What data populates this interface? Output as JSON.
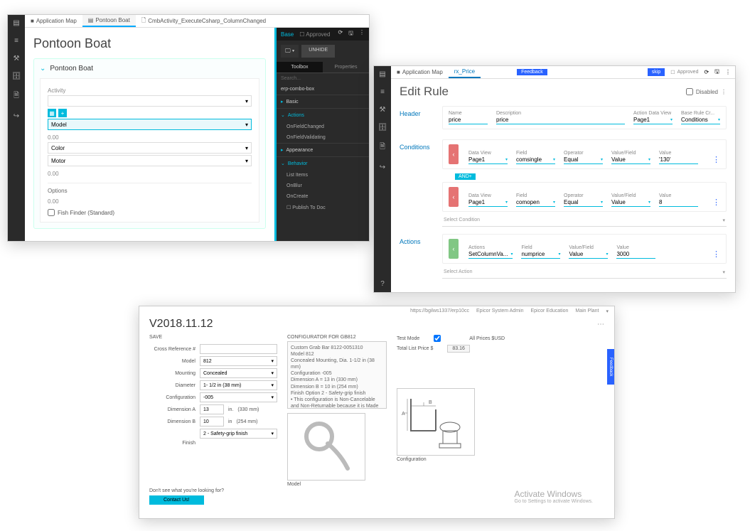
{
  "winA": {
    "tabs": [
      "Application Map",
      "Pontoon Boat",
      "CmbActivity_ExecuteCsharp_ColumnChanged"
    ],
    "title": "Pontoon Boat",
    "card_title": "Pontoon Boat",
    "fields": {
      "activity": "Activity",
      "model": "Model",
      "num1": "0.00",
      "color": "Color",
      "motor": "Motor",
      "num2": "0.00",
      "options": "Options",
      "num3": "0.00",
      "fish": "Fish Finder (Standard)"
    },
    "right": {
      "state_base": "Base",
      "state_approved": "Approved",
      "unhide": "UNHIDE",
      "panetabs": [
        "Toolbox",
        "Properties"
      ],
      "search": "Search...",
      "crumb": "erp-combo-box",
      "sections": {
        "basic": "Basic",
        "actions": "Actions",
        "appearance": "Appearance",
        "behavior": "Behavior"
      },
      "items": {
        "onfieldchanged": "OnFieldChanged",
        "onfieldvalidating": "OnFieldValidating",
        "listitems": "List Items",
        "onblur": "OnBlur",
        "oncreate": "OnCreate",
        "publish": "Publish To Doc"
      }
    }
  },
  "winB": {
    "tabs": [
      "Application Map",
      "rx_Price"
    ],
    "feedback": "Feedback",
    "skip": "skip",
    "approved": "Approved",
    "title": "Edit Rule",
    "disabled": "Disabled",
    "labels": {
      "header": "Header",
      "conditions": "Conditions",
      "actions": "Actions"
    },
    "header": {
      "name_l": "Name",
      "name_v": "price",
      "desc_l": "Description",
      "desc_v": "price",
      "adv_l": "Action Data View",
      "adv_v": "Page1",
      "brc_l": "Base Rule Cr...",
      "brc_v": "Conditions"
    },
    "cond1": {
      "dv_l": "Data View",
      "dv_v": "Page1",
      "f_l": "Field",
      "f_v": "comsingle",
      "op_l": "Operator",
      "op_v": "Equal",
      "vf_l": "Value/Field",
      "vf_v": "Value",
      "val_l": "Value",
      "val_v": "'130'"
    },
    "and": "AND+",
    "cond2": {
      "dv_l": "Data View",
      "dv_v": "Page1",
      "f_l": "Field",
      "f_v": "comopen",
      "op_l": "Operator",
      "op_v": "Equal",
      "vf_l": "Value/Field",
      "vf_v": "Value",
      "val_l": "Value",
      "val_v": "8"
    },
    "selcond": "Select Condition",
    "action": {
      "a_l": "Actions",
      "a_v": "SetColumnVa...",
      "f_l": "Field",
      "f_v": "numprice",
      "vf_l": "Value/Field",
      "vf_v": "Value",
      "val_l": "Value",
      "val_v": "3000"
    },
    "selact": "Select Action"
  },
  "winC": {
    "bar": [
      "https://bgilws1337/erp10cc",
      "Epicor System Admin",
      "Epicor Education",
      "Main Plant"
    ],
    "version": "V2018.11.12",
    "save": "SAVE",
    "form": {
      "cross": "Cross Reference #",
      "model_l": "Model",
      "model_v": "812",
      "mount_l": "Mounting",
      "mount_v": "Concealed",
      "diam_l": "Diameter",
      "diam_v": "1- 1/2 in (38 mm)",
      "conf_l": "Configuration",
      "conf_v": "-005",
      "dima_l": "Dimension A",
      "dima_v": "13",
      "dima_u": "in.",
      "dima_mm": "(330 mm)",
      "dimb_l": "Dimension B",
      "dimb_v": "10",
      "dimb_u": "in",
      "dimb_mm": "(254 mm)",
      "finish_sel": "2 - Safety-grip finish",
      "finish_l": "Finish"
    },
    "cfg_title": "CONFIGURATOR FOR GB812",
    "cfg_text": "Custom Grab Bar 8122-0051310\nModel 812\nConcealed Mounting, Dia. 1-1/2 in (38 mm)\nConfiguration -005\nDimension A = 13 in  (330 mm)\nDimension B = 10 in  (254 mm)\nFinish Option 2 - Safety-grip finish\n• This configuration is Non-Cancelable and Non-Returnable because it is Made to Exact",
    "test_mode": "Test Mode",
    "prices": "All Prices $USD",
    "total_l": "Total List Price $",
    "total_v": "83.16",
    "foot": "Don't see what you're looking for?",
    "contact": "Contact Us!",
    "img_model": "Model",
    "img_conf": "Configuration",
    "feedback": "Feedback",
    "wm_t": "Activate Windows",
    "wm_s": "Go to Settings to activate Windows."
  }
}
